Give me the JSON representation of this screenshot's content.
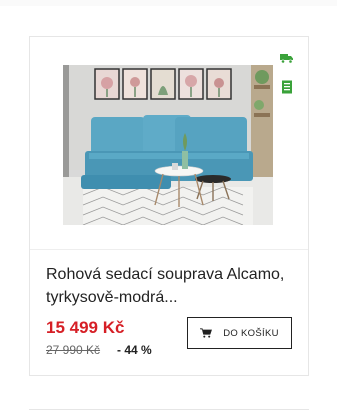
{
  "product": {
    "title": "Rohová sedací souprava Alcamo, tyrkysově-modrá...",
    "price_current": "15 499 Kč",
    "price_old": "27 990 Kč",
    "discount": "- 44 %",
    "add_to_cart_label": "DO KOŠÍKU",
    "badges": [
      "truck-icon",
      "stock-icon"
    ],
    "image": "sofa-photo"
  },
  "colors": {
    "price_red": "#d61f26",
    "badge_green": "#3aa23a",
    "sofa_turquoise": "#4aa0c0"
  }
}
